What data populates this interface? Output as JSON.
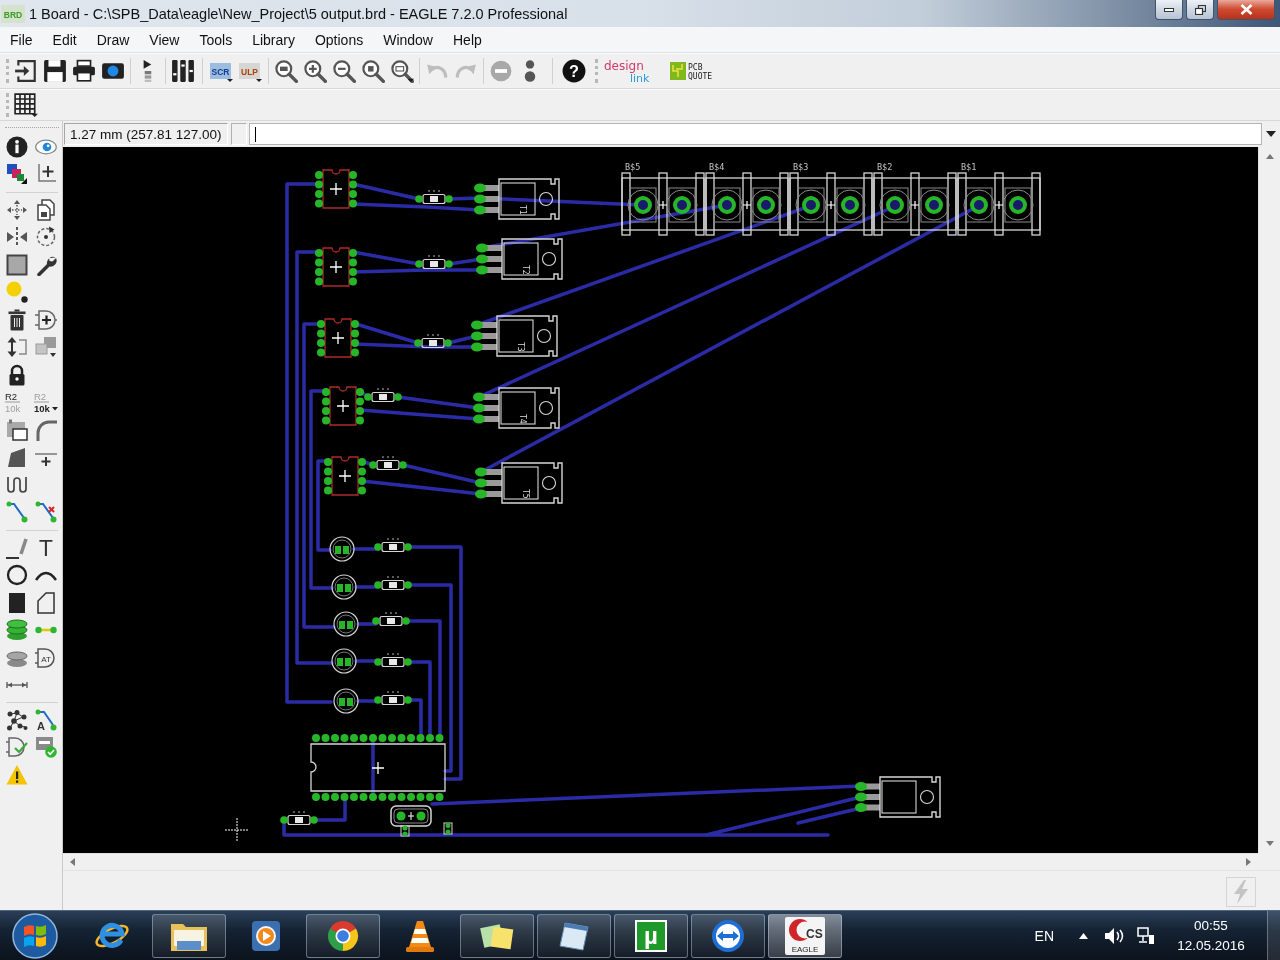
{
  "window": {
    "app_badge": "BRD",
    "title": "1 Board - C:\\SPB_Data\\eagle\\New_Project\\5 output.brd - EAGLE 7.2.0 Professional"
  },
  "menu": [
    "File",
    "Edit",
    "Draw",
    "View",
    "Tools",
    "Library",
    "Options",
    "Window",
    "Help"
  ],
  "toolbar": {
    "script_button": "SCR",
    "ulp_button": "ULP",
    "history": [
      {
        "kind": "undo",
        "disabled": true
      },
      {
        "kind": "redo",
        "disabled": true
      }
    ],
    "run_controls": [
      {
        "kind": "stop",
        "disabled": true
      },
      {
        "kind": "go",
        "disabled": false
      }
    ],
    "help_button": "?",
    "design_link": {
      "top": "design",
      "bottom": "link"
    },
    "pcb_quote": {
      "top": "PCB",
      "bottom": "QUOTE"
    }
  },
  "command_line": {
    "coordinates": "1.27 mm (257.81 127.00)",
    "focused": true
  },
  "tool_palette": {
    "label_tools": [
      {
        "top": "R2",
        "bottom": "10k",
        "bottom_active": false,
        "menu": false
      },
      {
        "top": "R2",
        "bottom": "10k",
        "bottom_active": true,
        "menu": true
      }
    ],
    "text_tool": "T",
    "attribute_tool": "AT",
    "autorouter_tool": "A"
  },
  "board": {
    "terminal_blocks": [
      {
        "label": "B$5"
      },
      {
        "label": "B$4"
      },
      {
        "label": "B$3"
      },
      {
        "label": "B$2"
      },
      {
        "label": "B$1"
      }
    ],
    "transistors": [
      {
        "label": "T1"
      },
      {
        "label": "T2"
      },
      {
        "label": "T3"
      },
      {
        "label": "T4"
      },
      {
        "label": "T5"
      }
    ]
  },
  "taskbar": {
    "apps": [
      {
        "kind": "browser_e",
        "running": false,
        "active": false
      },
      {
        "kind": "folder",
        "running": true,
        "active": false
      },
      {
        "kind": "player",
        "running": false,
        "active": false
      },
      {
        "kind": "browser",
        "running": true,
        "active": false
      },
      {
        "kind": "cone",
        "running": false,
        "active": false
      },
      {
        "kind": "notes",
        "running": true,
        "active": false
      },
      {
        "kind": "notepad",
        "running": true,
        "active": false
      },
      {
        "kind": "torrent",
        "running": true,
        "active": false,
        "glyph": "µ"
      },
      {
        "kind": "remote",
        "running": true,
        "active": false
      },
      {
        "kind": "eagle",
        "running": true,
        "active": true,
        "top": "CS",
        "bottom": "EAGLE"
      }
    ],
    "tray": {
      "language": "EN",
      "time": "00:55",
      "date": "12.05.2016"
    }
  }
}
